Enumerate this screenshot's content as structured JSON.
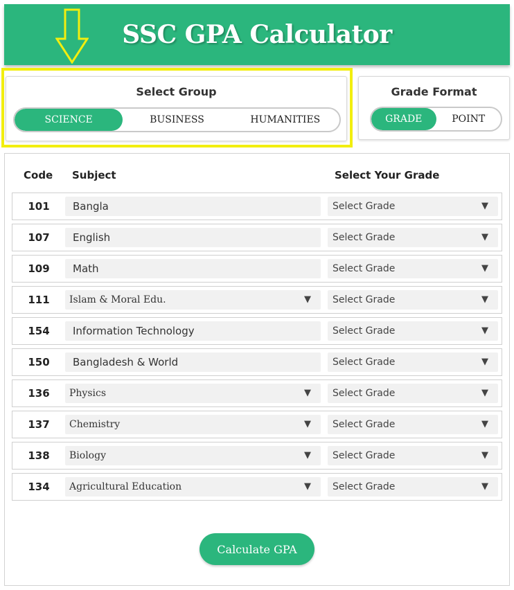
{
  "header": {
    "title": "SSC GPA Calculator"
  },
  "annotation": {
    "arrow_color": "#f2ee0f",
    "highlight_color": "#f2ee0f"
  },
  "colors": {
    "accent": "#2bb67d"
  },
  "group": {
    "title": "Select Group",
    "options": [
      "SCIENCE",
      "BUSINESS",
      "HUMANITIES"
    ],
    "selected": "SCIENCE"
  },
  "format": {
    "title": "Grade Format",
    "options": [
      "GRADE",
      "POINT"
    ],
    "selected": "GRADE"
  },
  "table": {
    "headers": {
      "code": "Code",
      "subject": "Subject",
      "grade": "Select Your Grade"
    },
    "rows": [
      {
        "code": "101",
        "subject": "Bangla",
        "subject_select": false,
        "grade": "Select Grade"
      },
      {
        "code": "107",
        "subject": "English",
        "subject_select": false,
        "grade": "Select Grade"
      },
      {
        "code": "109",
        "subject": "Math",
        "subject_select": false,
        "grade": "Select Grade"
      },
      {
        "code": "111",
        "subject": "Islam & Moral Edu.",
        "subject_select": true,
        "grade": "Select Grade"
      },
      {
        "code": "154",
        "subject": "Information Technology",
        "subject_select": false,
        "grade": "Select Grade"
      },
      {
        "code": "150",
        "subject": "Bangladesh & World",
        "subject_select": false,
        "grade": "Select Grade"
      },
      {
        "code": "136",
        "subject": "Physics",
        "subject_select": true,
        "grade": "Select Grade"
      },
      {
        "code": "137",
        "subject": "Chemistry",
        "subject_select": true,
        "grade": "Select Grade"
      },
      {
        "code": "138",
        "subject": "Biology",
        "subject_select": true,
        "grade": "Select Grade"
      },
      {
        "code": "134",
        "subject": "Agricultural Education",
        "subject_select": true,
        "grade": "Select Grade"
      }
    ]
  },
  "caret_icon": "▼",
  "calculate_button": {
    "label": "Calculate GPA"
  }
}
